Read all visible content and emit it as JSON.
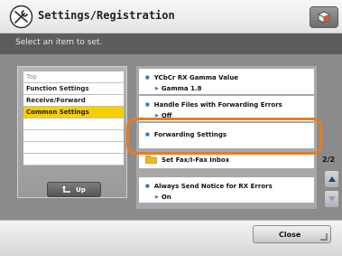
{
  "header": {
    "title": "Settings/Registration",
    "title_icon": "settings-tools-icon",
    "right_icon": "cube-icon"
  },
  "instruction": "Select an item to set.",
  "tree": {
    "items": [
      {
        "label": "Top"
      },
      {
        "label": "Function Settings"
      },
      {
        "label": "Receive/Forward"
      },
      {
        "label": "Common Settings",
        "selected": true
      },
      {
        "label": ""
      },
      {
        "label": ""
      },
      {
        "label": ""
      },
      {
        "label": ""
      }
    ],
    "up_label": "Up",
    "up_icon": "up-arrow-icon"
  },
  "settings_list": {
    "items": [
      {
        "label": "YCbCr RX Gamma Value",
        "value": "Gamma 1.8"
      },
      {
        "label": "Handle Files with Forwarding Errors",
        "value": "Off"
      },
      {
        "label": "Forwarding Settings"
      },
      {
        "label": "Set Fax/I-Fax Inbox",
        "icon": "folder-icon"
      },
      {
        "label": "Always Send Notice for RX Errors",
        "value": "On"
      }
    ]
  },
  "pagination": {
    "indicator": "2/2",
    "up_icon": "scroll-up-icon",
    "down_icon": "scroll-down-icon"
  },
  "footer": {
    "close_label": "Close"
  },
  "colors": {
    "highlight": "#e87d1e",
    "selected": "#f5d000",
    "bullet": "#3a6fb8"
  }
}
